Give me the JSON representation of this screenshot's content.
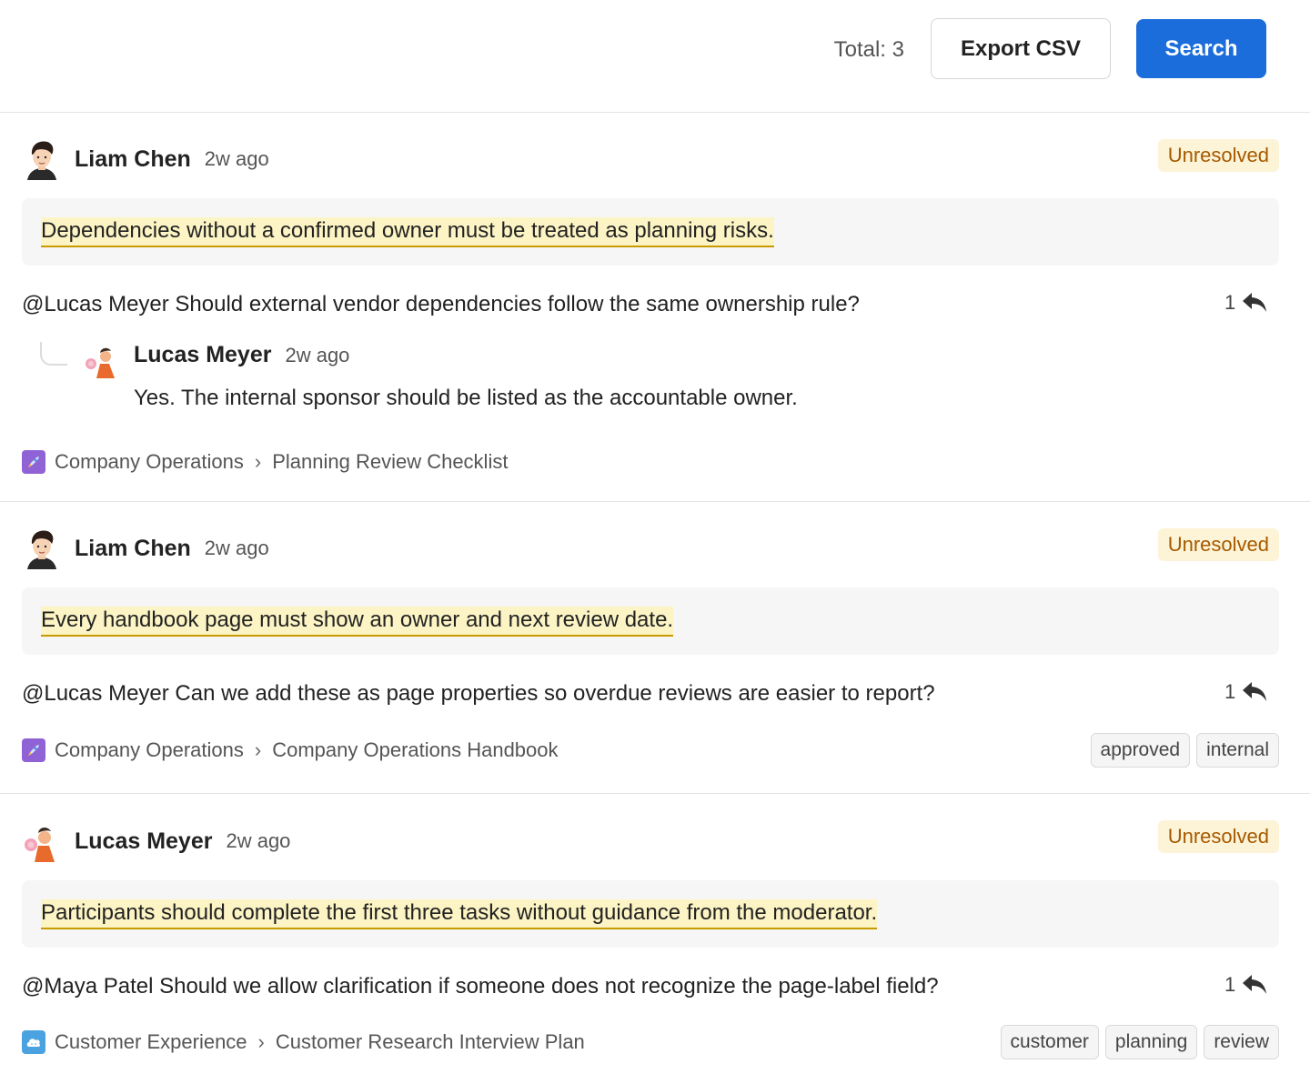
{
  "toolbar": {
    "total_label": "Total: 3",
    "export_label": "Export CSV",
    "search_label": "Search"
  },
  "comments": [
    {
      "author": "Liam Chen",
      "time": "2w ago",
      "status": "Unresolved",
      "quote": "Dependencies without a confirmed owner must be treated as planning risks.",
      "text": "@Lucas Meyer Should external vendor dependencies follow the same ownership rule?",
      "reply_count": "1",
      "reply": {
        "author": "Lucas Meyer",
        "time": "2w ago",
        "text": "Yes. The internal sponsor should be listed as the accountable owner."
      },
      "space": "Company Operations",
      "page": "Planning Review Checklist",
      "tags": []
    },
    {
      "author": "Liam Chen",
      "time": "2w ago",
      "status": "Unresolved",
      "quote": "Every handbook page must show an owner and next review date.",
      "text": "@Lucas Meyer Can we add these as page properties so overdue reviews are easier to report?",
      "reply_count": "1",
      "space": "Company Operations",
      "page": "Company Operations Handbook",
      "tags": [
        "approved",
        "internal"
      ]
    },
    {
      "author": "Lucas Meyer",
      "time": "2w ago",
      "status": "Unresolved",
      "quote": "Participants should complete the first three tasks without guidance from the moderator.",
      "text": "@Maya Patel Should we allow clarification if someone does not recognize the page-label field?",
      "reply_count": "1",
      "space": "Customer Experience",
      "page": "Customer Research Interview Plan",
      "tags": [
        "customer",
        "planning",
        "review"
      ]
    }
  ],
  "colors": {
    "primary": "#1a6ddb",
    "status_bg": "#fdf3d6",
    "status_text": "#a55a00",
    "highlight": "#fcf4c4"
  },
  "icons": {
    "space_operations": "rocket-icon",
    "space_customer": "cloud-icon",
    "reply": "reply-arrow-icon"
  }
}
